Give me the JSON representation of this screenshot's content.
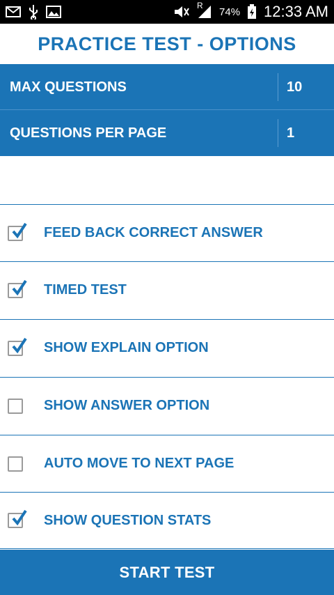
{
  "status_bar": {
    "icons_left": [
      "mail-icon",
      "usb-icon",
      "image-icon"
    ],
    "icons_right": [
      "mute-icon",
      "signal-icon",
      "battery-icon"
    ],
    "roaming_label": "R",
    "battery": "74%",
    "time": "12:33 AM"
  },
  "title": "PRACTICE TEST - OPTIONS",
  "settings": {
    "max_questions": {
      "label": "MAX QUESTIONS",
      "value": "10"
    },
    "questions_per_page": {
      "label": "QUESTIONS PER PAGE",
      "value": "1"
    }
  },
  "options": [
    {
      "label": "FEED BACK CORRECT ANSWER",
      "checked": true
    },
    {
      "label": "TIMED TEST",
      "checked": true
    },
    {
      "label": "SHOW EXPLAIN OPTION",
      "checked": true
    },
    {
      "label": "SHOW ANSWER OPTION",
      "checked": false
    },
    {
      "label": "AUTO MOVE TO NEXT PAGE",
      "checked": false
    },
    {
      "label": "SHOW QUESTION STATS",
      "checked": true
    }
  ],
  "start_button": "START TEST",
  "colors": {
    "accent": "#1b74b6",
    "checkmark": "#1b74b6",
    "checkbox_border": "#9a9a9a"
  }
}
